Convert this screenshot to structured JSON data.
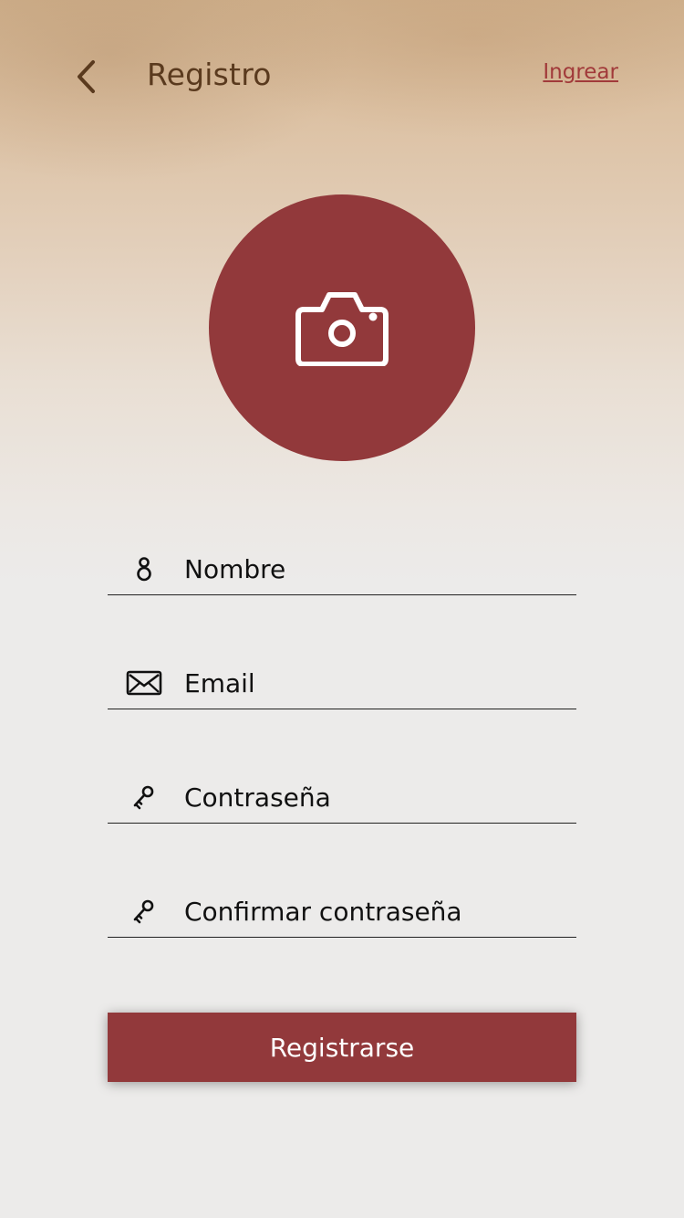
{
  "header": {
    "title": "Registro",
    "login_link": "Ingrear",
    "back_icon": "chevron-left-icon"
  },
  "avatar": {
    "icon": "camera-icon",
    "color": "#92393b"
  },
  "form": {
    "fields": [
      {
        "placeholder": "Nombre",
        "icon": "user-icon",
        "value": ""
      },
      {
        "placeholder": "Email",
        "icon": "envelope-icon",
        "value": ""
      },
      {
        "placeholder": "Contraseña",
        "icon": "key-icon",
        "value": ""
      },
      {
        "placeholder": "Confirmar contraseña",
        "icon": "key-icon",
        "value": ""
      }
    ],
    "submit_label": "Registrarse"
  },
  "colors": {
    "accent": "#92393b",
    "title": "#5a3a1e",
    "link": "#a13a3a"
  }
}
